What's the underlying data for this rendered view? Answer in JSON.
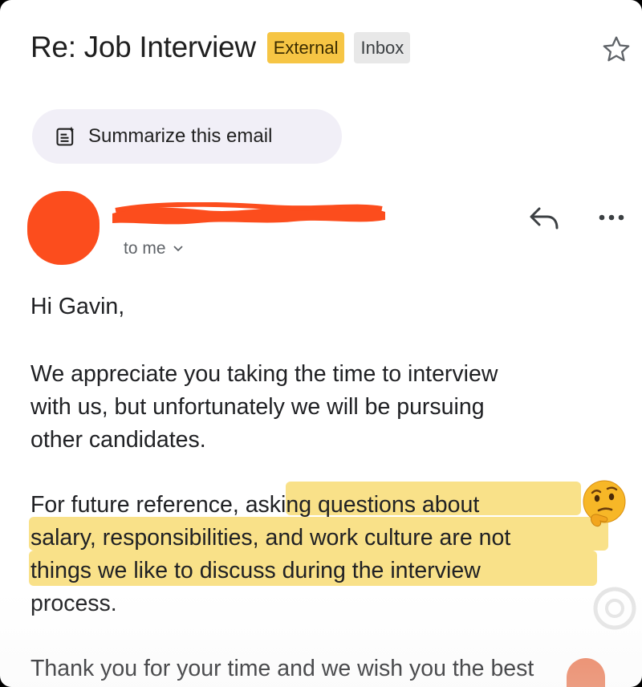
{
  "email": {
    "subject": "Re: Job Interview",
    "labels": {
      "external": "External",
      "inbox": "Inbox"
    },
    "summarize_label": "Summarize this email",
    "recipient_label": "to me",
    "body": {
      "greeting": "Hi Gavin,",
      "para1": [
        "We appreciate you taking the time to interview",
        "with us, but unfortunately we will be pursuing",
        "other candidates."
      ],
      "para2": [
        "For future reference, asking questions about",
        "salary, responsibilities, and work culture are not",
        "things we like to discuss during the interview",
        "process."
      ],
      "closing": "Thank you for your time and we wish you the best"
    }
  },
  "icons": {
    "star": "star-outline-icon",
    "summarize": "summarize-sparkle-icon",
    "reply": "reply-arrow-icon",
    "more": "more-horizontal-icon",
    "emoji": "thinking-face-emoji"
  },
  "colors": {
    "external_badge": "#f6c544",
    "inbox_badge": "#e8e8e8",
    "summarize_chip": "#f1eff7",
    "redaction": "#fc4d1d",
    "highlight": "#f6d65c"
  }
}
